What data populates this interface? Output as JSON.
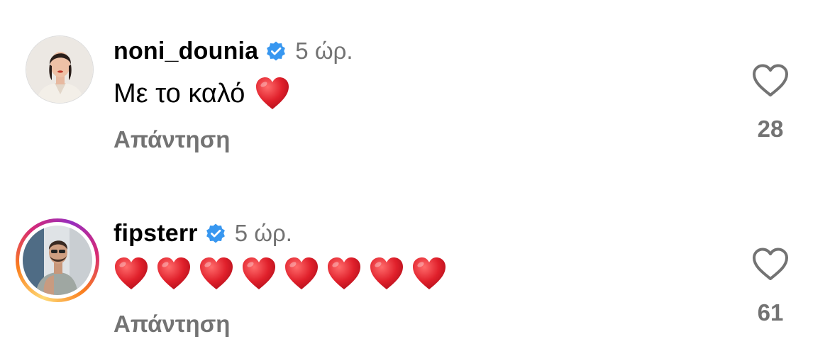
{
  "comments": [
    {
      "username": "noni_dounia",
      "time": "5 ώρ.",
      "text": "Με το καλό",
      "emoji_count": 1,
      "reply_label": "Απάντηση",
      "likes": "28",
      "avatar": "profile-photo-woman"
    },
    {
      "username": "fipsterr",
      "time": "5 ώρ.",
      "text": "",
      "emoji_count": 8,
      "reply_label": "Απάντηση",
      "likes": "61",
      "avatar": "profile-photo-man-story-ring"
    }
  ],
  "colors": {
    "verified": "#3897f0",
    "secondary_text": "#737373",
    "heart_emoji": "#e0202b"
  },
  "icons": {
    "verified": "verified-badge-icon",
    "like": "heart-outline-icon",
    "emoji": "red-heart-emoji"
  }
}
